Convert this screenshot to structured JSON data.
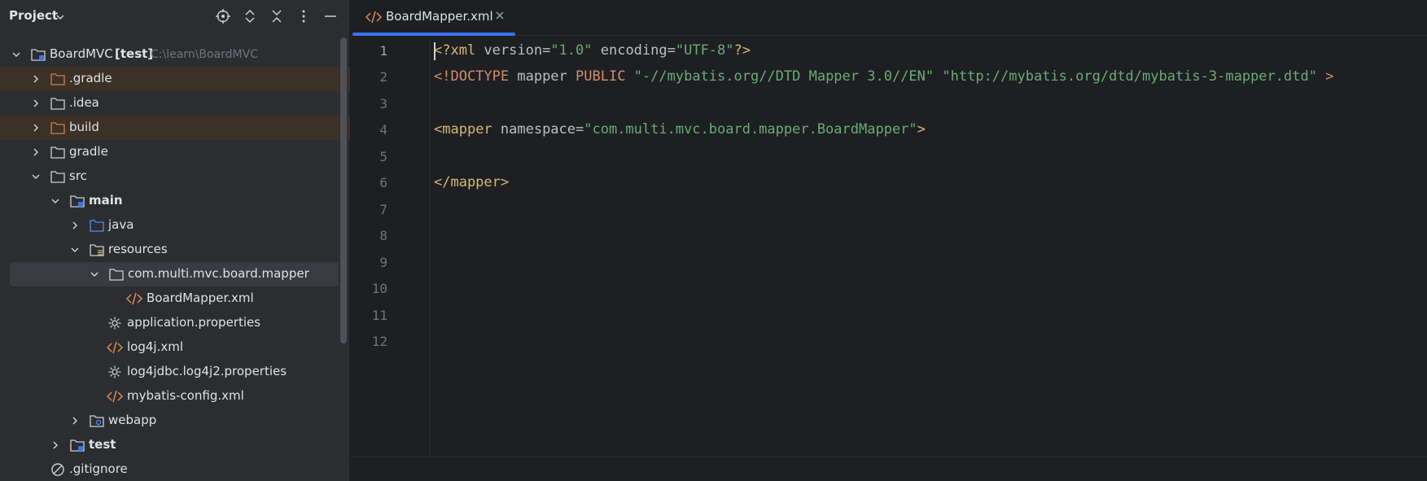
{
  "panel": {
    "title": "Project"
  },
  "tree": [
    {
      "label": "BoardMVC",
      "bold_suffix": "[test]",
      "hint": "C:\\learn\\BoardMVC",
      "icon": "module-folder-icon",
      "expanded": true
    },
    {
      "label": ".gradle",
      "icon": "folder-excluded-icon",
      "expanded": false,
      "excluded": true
    },
    {
      "label": ".idea",
      "icon": "folder-icon",
      "expanded": false
    },
    {
      "label": "build",
      "icon": "folder-excluded-icon",
      "expanded": false,
      "excluded": true
    },
    {
      "label": "gradle",
      "icon": "folder-icon",
      "expanded": false
    },
    {
      "label": "src",
      "icon": "folder-icon",
      "expanded": true
    },
    {
      "label": "main",
      "icon": "source-root-folder-icon",
      "expanded": true,
      "bold": true
    },
    {
      "label": "java",
      "icon": "java-source-folder-icon",
      "expanded": false
    },
    {
      "label": "resources",
      "icon": "resources-folder-icon",
      "expanded": true
    },
    {
      "label": "com.multi.mvc.board.mapper",
      "icon": "package-folder-icon",
      "expanded": true,
      "selected": true
    },
    {
      "label": "BoardMapper.xml",
      "icon": "xml-file-icon"
    },
    {
      "label": "application.properties",
      "icon": "properties-file-icon"
    },
    {
      "label": "log4j.xml",
      "icon": "xml-file-icon"
    },
    {
      "label": "log4jdbc.log4j2.properties",
      "icon": "properties-file-icon"
    },
    {
      "label": "mybatis-config.xml",
      "icon": "xml-file-icon"
    },
    {
      "label": "webapp",
      "icon": "web-folder-icon",
      "expanded": false
    },
    {
      "label": "test",
      "icon": "source-root-folder-icon",
      "expanded": false,
      "bold": true
    },
    {
      "label": ".gitignore",
      "icon": "ignored-file-icon"
    }
  ],
  "editor": {
    "tab_label": "BoardMapper.xml",
    "line_numbers": [
      "1",
      "2",
      "3",
      "4",
      "5",
      "6",
      "7",
      "8",
      "9",
      "10",
      "11",
      "12"
    ],
    "lines": {
      "l1": {
        "open": "<?xml",
        "a1": " version=",
        "v1": "\"1.0\"",
        "a2": " encoding=",
        "v2": "\"UTF-8\"",
        "close": "?>"
      },
      "l2": {
        "open": "<!DOCTYPE",
        "k1": " mapper",
        "k2": " PUBLIC",
        "s1": " \"-//mybatis.org//DTD Mapper 3.0//EN\"",
        "s2": " \"http://mybatis.org/dtd/mybatis-3-mapper.dtd\"",
        "close": " >"
      },
      "l4": {
        "open": "<mapper",
        "a1": " namespace=",
        "v1": "\"com.multi.mvc.board.mapper.BoardMapper\"",
        "close": ">"
      },
      "l6": {
        "tag": "</mapper>"
      }
    }
  },
  "colors": {
    "accent": "#3574f0",
    "tag": "#d5b778",
    "string": "#6aab73",
    "excluded_bg": "#3b3126"
  }
}
